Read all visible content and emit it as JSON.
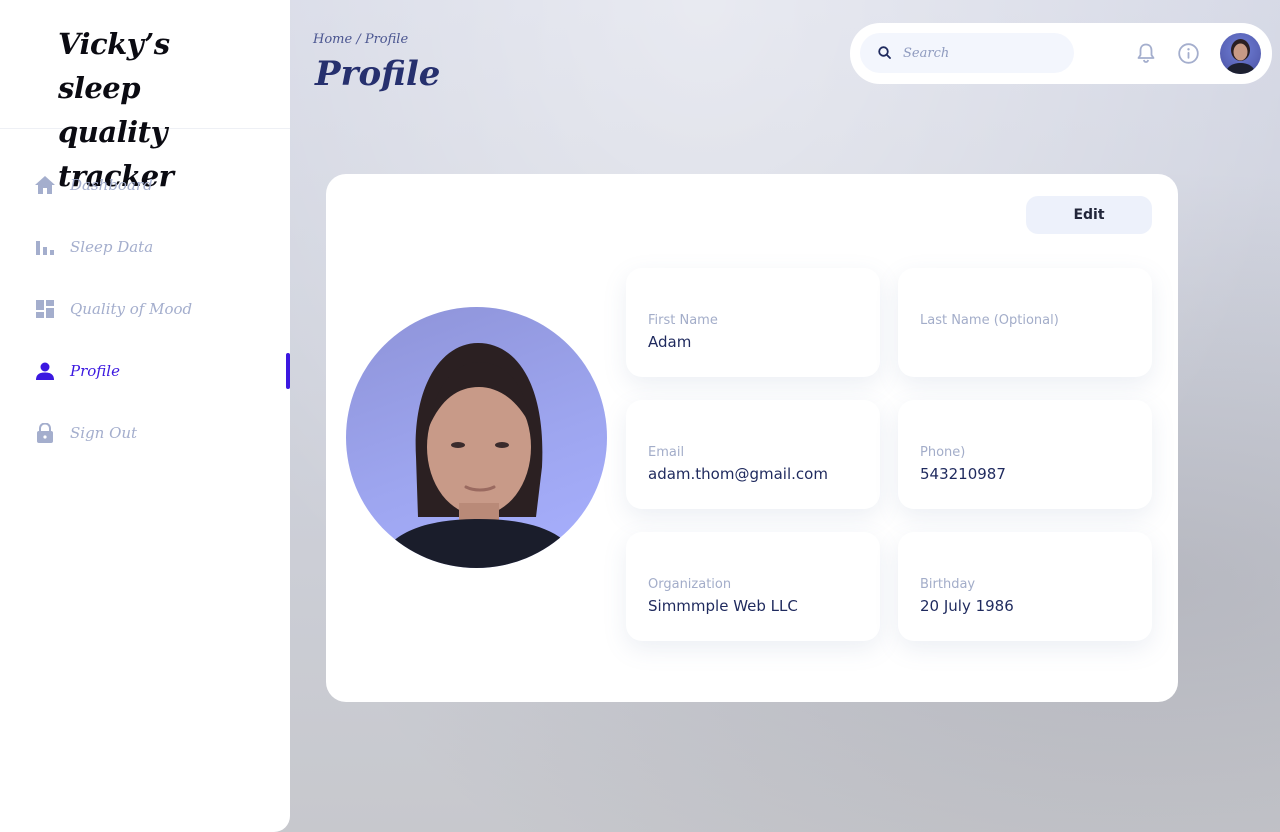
{
  "sidebar": {
    "brand": "Vicky’s sleep quality tracker",
    "items": [
      {
        "label": "Dashboard",
        "icon": "home-icon"
      },
      {
        "label": "Sleep Data",
        "icon": "bar-chart-icon"
      },
      {
        "label": "Quality of Mood",
        "icon": "dashboard-grid-icon"
      },
      {
        "label": "Profile",
        "icon": "user-icon",
        "active": true
      },
      {
        "label": "Sign Out",
        "icon": "lock-icon"
      }
    ]
  },
  "header": {
    "breadcrumb": "Home / Profile",
    "title": "Profile",
    "search_placeholder": "Search"
  },
  "profile": {
    "edit_label": "Edit",
    "fields": [
      {
        "label": "First Name",
        "value": "Adam"
      },
      {
        "label": "Last Name (Optional)",
        "value": ""
      },
      {
        "label": "Email",
        "value": "adam.thom@gmail.com"
      },
      {
        "label": "Phone)",
        "value": "543210987"
      },
      {
        "label": "Organization",
        "value": "Simmmple Web LLC"
      },
      {
        "label": "Birthday",
        "value": "20 July 1986"
      }
    ]
  },
  "colors": {
    "accent": "#3b18e0",
    "nav_text": "#a4aecd",
    "title": "#26306e",
    "field_value": "#1f2a5e"
  }
}
